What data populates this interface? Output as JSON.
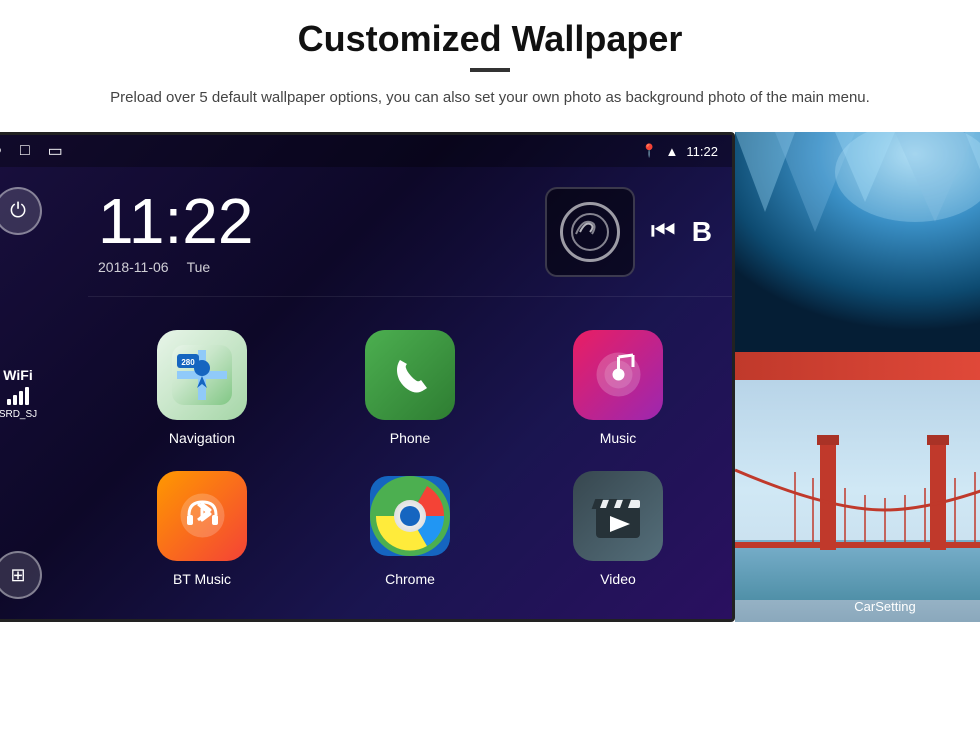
{
  "header": {
    "title": "Customized Wallpaper",
    "subtitle": "Preload over 5 default wallpaper options, you can also set your own photo as background photo of the main menu."
  },
  "status_bar": {
    "time": "11:22",
    "nav_back": "◁",
    "nav_home": "○",
    "nav_recent": "□",
    "nav_screenshot": "⬜"
  },
  "clock": {
    "time": "11:22",
    "date": "2018-11-06",
    "day": "Tue"
  },
  "wifi": {
    "label": "WiFi",
    "ssid": "SRD_SJ"
  },
  "apps": [
    {
      "name": "Navigation",
      "type": "navigation"
    },
    {
      "name": "Phone",
      "type": "phone"
    },
    {
      "name": "Music",
      "type": "music"
    },
    {
      "name": "BT Music",
      "type": "bt-music"
    },
    {
      "name": "Chrome",
      "type": "chrome"
    },
    {
      "name": "Video",
      "type": "video"
    }
  ],
  "wallpapers": [
    {
      "name": "ice-cave",
      "label": ""
    },
    {
      "name": "golden-gate",
      "label": "CarSetting"
    }
  ]
}
